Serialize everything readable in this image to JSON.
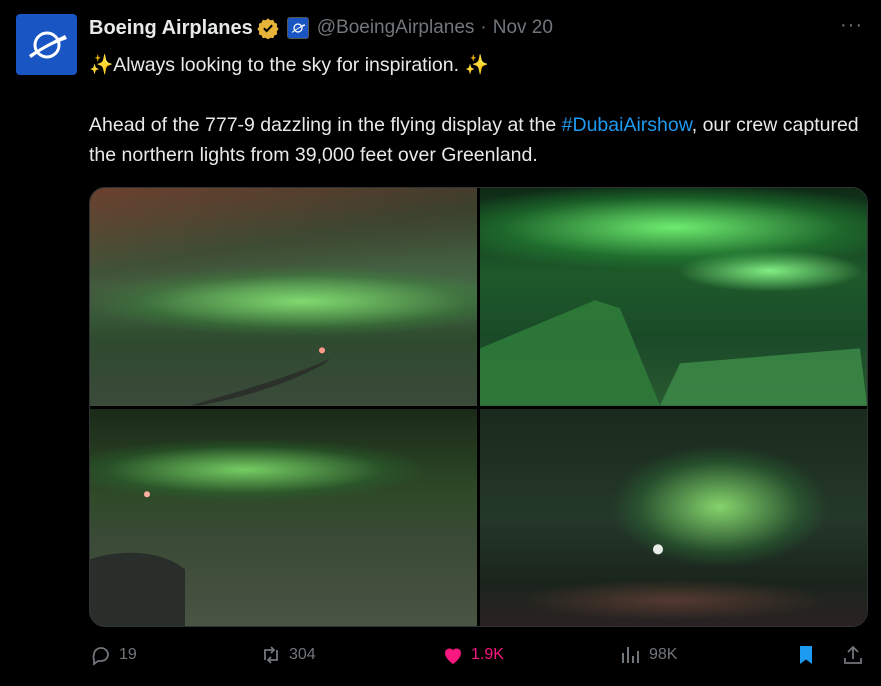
{
  "post": {
    "author_name": "Boeing Airplanes",
    "author_handle": "@BoeingAirplanes",
    "separator": "·",
    "date": "Nov 20",
    "more": "···",
    "text_line1": "✨Always looking to the sky for inspiration. ✨",
    "text_p2_before": "Ahead of the 777-9 dazzling in the flying display at the ",
    "hashtag": "#DubaiAirshow",
    "text_p2_after": ", our crew captured the northern lights from 39,000 feet over Greenland."
  },
  "media": {
    "count": 4
  },
  "actions": {
    "replies": "19",
    "reposts": "304",
    "likes": "1.9K",
    "views": "98K"
  },
  "icons": {
    "verified": "verified-gold-badge-icon",
    "affiliate": "boeing-affiliate-icon",
    "reply": "reply-icon",
    "repost": "repost-icon",
    "like": "heart-icon",
    "views": "views-icon",
    "bookmark": "bookmark-icon",
    "share": "share-icon"
  },
  "colors": {
    "background": "#000000",
    "text": "#e7e9ea",
    "muted": "#71767b",
    "link": "#1d9bf0",
    "like": "#f91880",
    "bookmark": "#1d9bf0",
    "verified": "#e7b339",
    "brand": "#1a55c4"
  }
}
